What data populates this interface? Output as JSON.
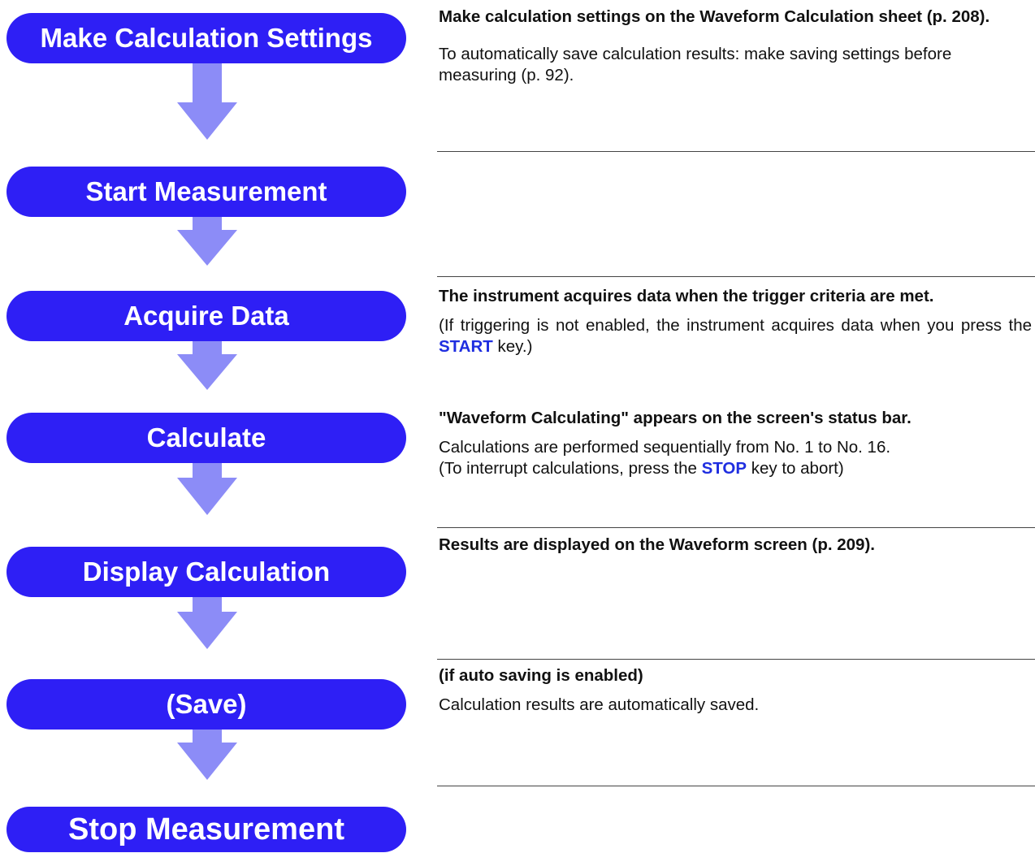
{
  "steps": [
    {
      "label": "Make Calculation Settings"
    },
    {
      "label": "Start Measurement"
    },
    {
      "label": "Acquire Data"
    },
    {
      "label": "Calculate"
    },
    {
      "label": "Display Calculation"
    },
    {
      "label": "(Save)"
    },
    {
      "label": "Stop Measurement"
    }
  ],
  "notes": {
    "settings": {
      "heading": "Make calculation settings on the Waveform Calculation sheet (p. 208).",
      "body": "To automatically save calculation results: make saving settings before measuring (p. 92)."
    },
    "acquire": {
      "heading": "The instrument acquires data when the trigger criteria are met.",
      "body_before": "(If triggering is not enabled, the instrument acquires data when you press the ",
      "key": "START",
      "body_after": " key.)"
    },
    "calculate": {
      "heading": "\"Waveform Calculating\" appears on the screen's status bar.",
      "line1": "Calculations are performed sequentially from No. 1 to No. 16.",
      "line2_before": "(To interrupt calculations, press the ",
      "key": "STOP",
      "line2_after": " key to abort)"
    },
    "display": {
      "heading": "Results are displayed on the Waveform screen (p. 209)."
    },
    "save": {
      "heading": "(if auto saving is enabled)",
      "body": "Calculation results are automatically saved."
    }
  },
  "colors": {
    "step_fill": "#2e1ff5",
    "step_text": "#ffffff",
    "arrow_fill": "#8c8cf7",
    "key_text": "#1f2ee0"
  }
}
